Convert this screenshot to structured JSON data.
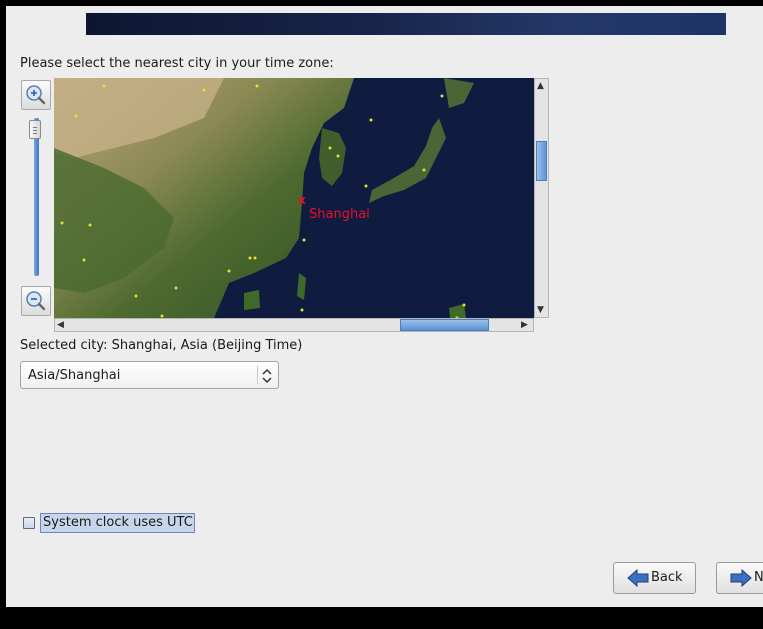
{
  "header": {
    "banner_colors": [
      "#0d1630",
      "#233869"
    ]
  },
  "timezone": {
    "prompt": "Please select the nearest city in your time zone:",
    "zoom_in_icon": "zoom-in-icon",
    "zoom_out_icon": "zoom-out-icon",
    "map": {
      "selected_marker": "x",
      "selected_city_label": "Shanghai",
      "marker_color": "#e8102a",
      "city_dot_color": "#e6e12a"
    },
    "selected_city_text": "Selected city: Shanghai, Asia (Beijing Time)",
    "combo_value": "Asia/Shanghai",
    "combo_icon": "up-down-arrows-icon"
  },
  "clock": {
    "utc_label": "System clock uses UTC",
    "utc_checked": false
  },
  "nav": {
    "back_label": "Back",
    "back_icon": "left-arrow-icon",
    "next_label": "Next",
    "next_icon": "right-arrow-icon"
  }
}
